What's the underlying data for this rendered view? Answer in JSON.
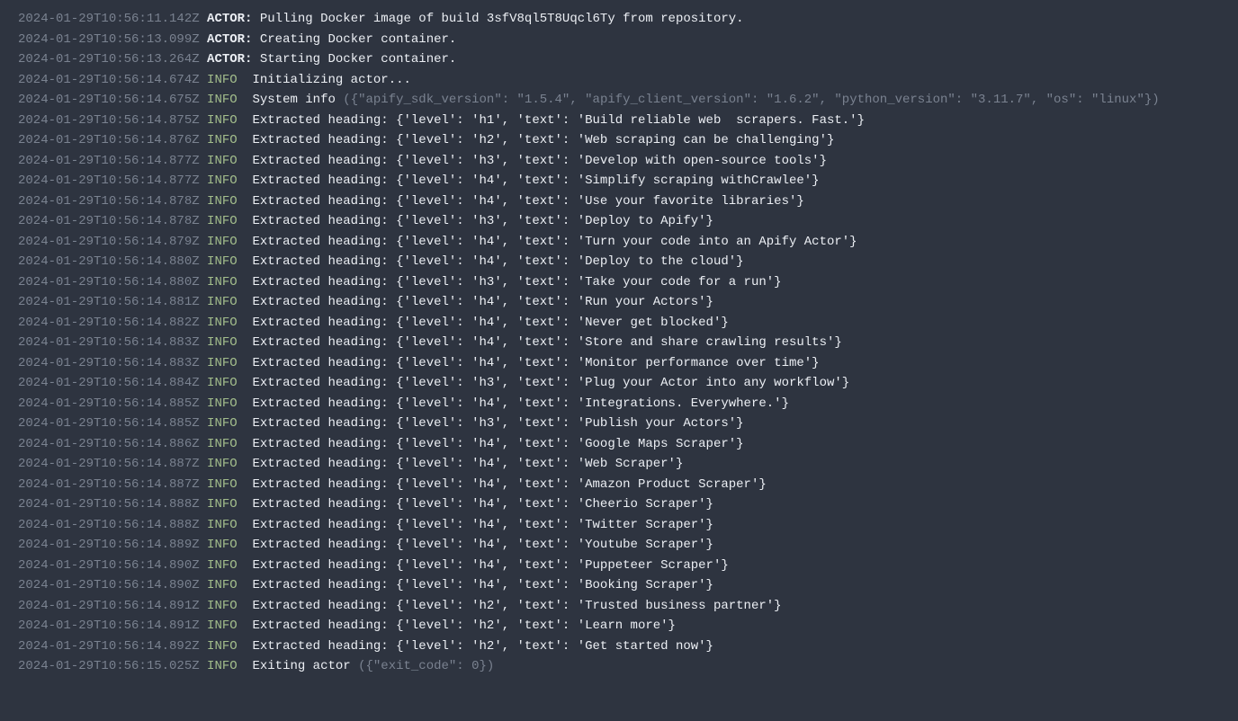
{
  "logs": [
    {
      "ts": "2024-01-29T10:56:11.142Z",
      "level": "ACTOR:",
      "msg": "Pulling Docker image of build 3sfV8ql5T8Uqcl6Ty from repository.",
      "type": "actor"
    },
    {
      "ts": "2024-01-29T10:56:13.099Z",
      "level": "ACTOR:",
      "msg": "Creating Docker container.",
      "type": "actor"
    },
    {
      "ts": "2024-01-29T10:56:13.264Z",
      "level": "ACTOR:",
      "msg": "Starting Docker container.",
      "type": "actor"
    },
    {
      "ts": "2024-01-29T10:56:14.674Z",
      "level": "INFO ",
      "msg": "Initializing actor...",
      "type": "info"
    },
    {
      "ts": "2024-01-29T10:56:14.675Z",
      "level": "INFO ",
      "msg": "System info ",
      "extra": "({\"apify_sdk_version\": \"1.5.4\", \"apify_client_version\": \"1.6.2\", \"python_version\": \"3.11.7\", \"os\": \"linux\"})",
      "type": "info"
    },
    {
      "ts": "2024-01-29T10:56:14.875Z",
      "level": "INFO ",
      "msg": "Extracted heading: {'level': 'h1', 'text': 'Build reliable web  scrapers. Fast.'}",
      "type": "info"
    },
    {
      "ts": "2024-01-29T10:56:14.876Z",
      "level": "INFO ",
      "msg": "Extracted heading: {'level': 'h2', 'text': 'Web scraping can be challenging'}",
      "type": "info"
    },
    {
      "ts": "2024-01-29T10:56:14.877Z",
      "level": "INFO ",
      "msg": "Extracted heading: {'level': 'h3', 'text': 'Develop with open-source tools'}",
      "type": "info"
    },
    {
      "ts": "2024-01-29T10:56:14.877Z",
      "level": "INFO ",
      "msg": "Extracted heading: {'level': 'h4', 'text': 'Simplify scraping withCrawlee'}",
      "type": "info"
    },
    {
      "ts": "2024-01-29T10:56:14.878Z",
      "level": "INFO ",
      "msg": "Extracted heading: {'level': 'h4', 'text': 'Use your favorite libraries'}",
      "type": "info"
    },
    {
      "ts": "2024-01-29T10:56:14.878Z",
      "level": "INFO ",
      "msg": "Extracted heading: {'level': 'h3', 'text': 'Deploy to Apify'}",
      "type": "info"
    },
    {
      "ts": "2024-01-29T10:56:14.879Z",
      "level": "INFO ",
      "msg": "Extracted heading: {'level': 'h4', 'text': 'Turn your code into an Apify Actor'}",
      "type": "info"
    },
    {
      "ts": "2024-01-29T10:56:14.880Z",
      "level": "INFO ",
      "msg": "Extracted heading: {'level': 'h4', 'text': 'Deploy to the cloud'}",
      "type": "info"
    },
    {
      "ts": "2024-01-29T10:56:14.880Z",
      "level": "INFO ",
      "msg": "Extracted heading: {'level': 'h3', 'text': 'Take your code for a run'}",
      "type": "info"
    },
    {
      "ts": "2024-01-29T10:56:14.881Z",
      "level": "INFO ",
      "msg": "Extracted heading: {'level': 'h4', 'text': 'Run your Actors'}",
      "type": "info"
    },
    {
      "ts": "2024-01-29T10:56:14.882Z",
      "level": "INFO ",
      "msg": "Extracted heading: {'level': 'h4', 'text': 'Never get blocked'}",
      "type": "info"
    },
    {
      "ts": "2024-01-29T10:56:14.883Z",
      "level": "INFO ",
      "msg": "Extracted heading: {'level': 'h4', 'text': 'Store and share crawling results'}",
      "type": "info"
    },
    {
      "ts": "2024-01-29T10:56:14.883Z",
      "level": "INFO ",
      "msg": "Extracted heading: {'level': 'h4', 'text': 'Monitor performance over time'}",
      "type": "info"
    },
    {
      "ts": "2024-01-29T10:56:14.884Z",
      "level": "INFO ",
      "msg": "Extracted heading: {'level': 'h3', 'text': 'Plug your Actor into any workflow'}",
      "type": "info"
    },
    {
      "ts": "2024-01-29T10:56:14.885Z",
      "level": "INFO ",
      "msg": "Extracted heading: {'level': 'h4', 'text': 'Integrations. Everywhere.'}",
      "type": "info"
    },
    {
      "ts": "2024-01-29T10:56:14.885Z",
      "level": "INFO ",
      "msg": "Extracted heading: {'level': 'h3', 'text': 'Publish your Actors'}",
      "type": "info"
    },
    {
      "ts": "2024-01-29T10:56:14.886Z",
      "level": "INFO ",
      "msg": "Extracted heading: {'level': 'h4', 'text': 'Google Maps Scraper'}",
      "type": "info"
    },
    {
      "ts": "2024-01-29T10:56:14.887Z",
      "level": "INFO ",
      "msg": "Extracted heading: {'level': 'h4', 'text': 'Web Scraper'}",
      "type": "info"
    },
    {
      "ts": "2024-01-29T10:56:14.887Z",
      "level": "INFO ",
      "msg": "Extracted heading: {'level': 'h4', 'text': 'Amazon Product Scraper'}",
      "type": "info"
    },
    {
      "ts": "2024-01-29T10:56:14.888Z",
      "level": "INFO ",
      "msg": "Extracted heading: {'level': 'h4', 'text': 'Cheerio Scraper'}",
      "type": "info"
    },
    {
      "ts": "2024-01-29T10:56:14.888Z",
      "level": "INFO ",
      "msg": "Extracted heading: {'level': 'h4', 'text': 'Twitter Scraper'}",
      "type": "info"
    },
    {
      "ts": "2024-01-29T10:56:14.889Z",
      "level": "INFO ",
      "msg": "Extracted heading: {'level': 'h4', 'text': 'Youtube Scraper'}",
      "type": "info"
    },
    {
      "ts": "2024-01-29T10:56:14.890Z",
      "level": "INFO ",
      "msg": "Extracted heading: {'level': 'h4', 'text': 'Puppeteer Scraper'}",
      "type": "info"
    },
    {
      "ts": "2024-01-29T10:56:14.890Z",
      "level": "INFO ",
      "msg": "Extracted heading: {'level': 'h4', 'text': 'Booking Scraper'}",
      "type": "info"
    },
    {
      "ts": "2024-01-29T10:56:14.891Z",
      "level": "INFO ",
      "msg": "Extracted heading: {'level': 'h2', 'text': 'Trusted business partner'}",
      "type": "info"
    },
    {
      "ts": "2024-01-29T10:56:14.891Z",
      "level": "INFO ",
      "msg": "Extracted heading: {'level': 'h2', 'text': 'Learn more'}",
      "type": "info"
    },
    {
      "ts": "2024-01-29T10:56:14.892Z",
      "level": "INFO ",
      "msg": "Extracted heading: {'level': 'h2', 'text': 'Get started now'}",
      "type": "info"
    },
    {
      "ts": "2024-01-29T10:56:15.025Z",
      "level": "INFO ",
      "msg": "Exiting actor ",
      "extra": "({\"exit_code\": 0})",
      "type": "info"
    }
  ]
}
